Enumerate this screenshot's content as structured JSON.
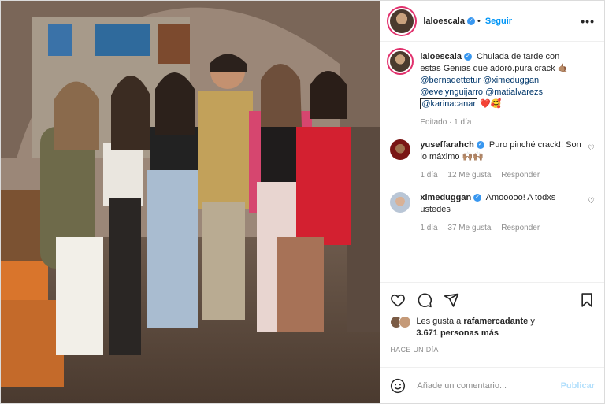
{
  "post": {
    "author": "laloescala",
    "follow_label": "Seguir",
    "more_label": "•••",
    "caption_text": "Chulada de tarde con estas Genias que adoró.pura crack",
    "caption_emoji": "🤙🏽",
    "mentions": [
      "@bernadettetur",
      "@ximeduggan",
      "@evelynguijarro",
      "@matialvarezs"
    ],
    "boxed_mention": "@karinacanar",
    "end_emojis": "❤️🥰",
    "caption_meta": "Editado · 1 día"
  },
  "comments": [
    {
      "user": "yuseffarahch",
      "text": "Puro pinché crack!! Son lo máximo",
      "emoji": "🙌🏽🙌🏽",
      "time": "1 día",
      "likes": "12 Me gusta",
      "reply": "Responder"
    },
    {
      "user": "ximeduggan",
      "text": "Amooooo! A todxs ustedes",
      "emoji": "",
      "time": "1 día",
      "likes": "37 Me gusta",
      "reply": "Responder"
    }
  ],
  "likes": {
    "prefix": "Les gusta a",
    "user": "rafamercadante",
    "and": "y",
    "others": "3.671 personas más"
  },
  "time_ago": "HACE UN DÍA",
  "add_comment": {
    "placeholder": "Añade un comentario...",
    "publish": "Publicar"
  },
  "icons": {
    "like": "heart-icon",
    "comment": "comment-icon",
    "share": "share-icon",
    "save": "bookmark-icon",
    "emoji": "emoji-icon"
  }
}
